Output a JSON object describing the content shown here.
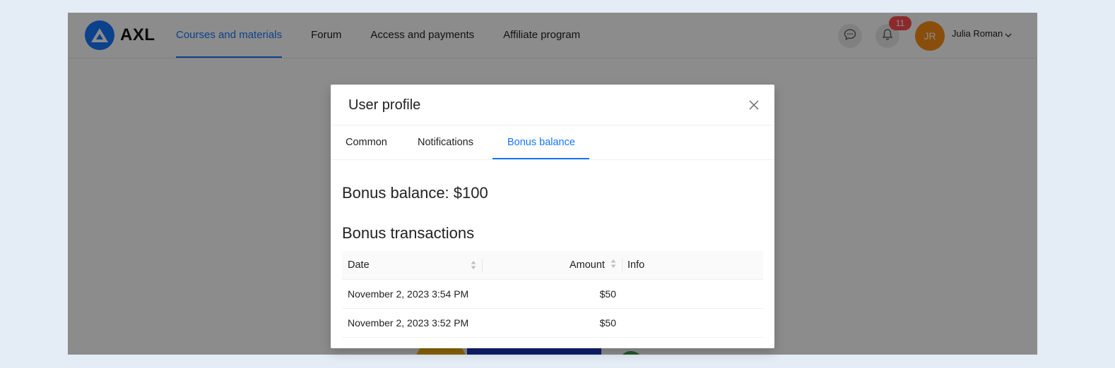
{
  "header": {
    "logo_text": "AXL",
    "nav": [
      {
        "label": "Courses and materials",
        "active": true
      },
      {
        "label": "Forum",
        "active": false
      },
      {
        "label": "Access and payments",
        "active": false
      },
      {
        "label": "Affiliate program",
        "active": false
      }
    ],
    "notification_count": "11",
    "user_initials": "JR",
    "user_name": "Julia Roman"
  },
  "modal": {
    "title": "User profile",
    "tabs": [
      {
        "label": "Common",
        "active": false
      },
      {
        "label": "Notifications",
        "active": false
      },
      {
        "label": "Bonus balance",
        "active": true
      }
    ],
    "balance_text": "Bonus balance: $100",
    "transactions_title": "Bonus transactions",
    "table": {
      "columns": [
        "Date",
        "Amount",
        "Info"
      ],
      "rows": [
        {
          "date": "November 2, 2023 3:54 PM",
          "amount": "$50",
          "info": ""
        },
        {
          "date": "November 2, 2023 3:52 PM",
          "amount": "$50",
          "info": ""
        }
      ]
    }
  },
  "colors": {
    "accent": "#1677ff",
    "badge": "#ff4d4f",
    "avatar": "#fa8c16",
    "page_background": "#e4ecf6"
  },
  "icons": {
    "logo": "triangle-logo-icon",
    "chat": "chat-bubble-icon",
    "notifications": "bell-icon",
    "user_menu": "chevron-down-icon",
    "close": "close-icon",
    "sort": "sort-icon"
  }
}
